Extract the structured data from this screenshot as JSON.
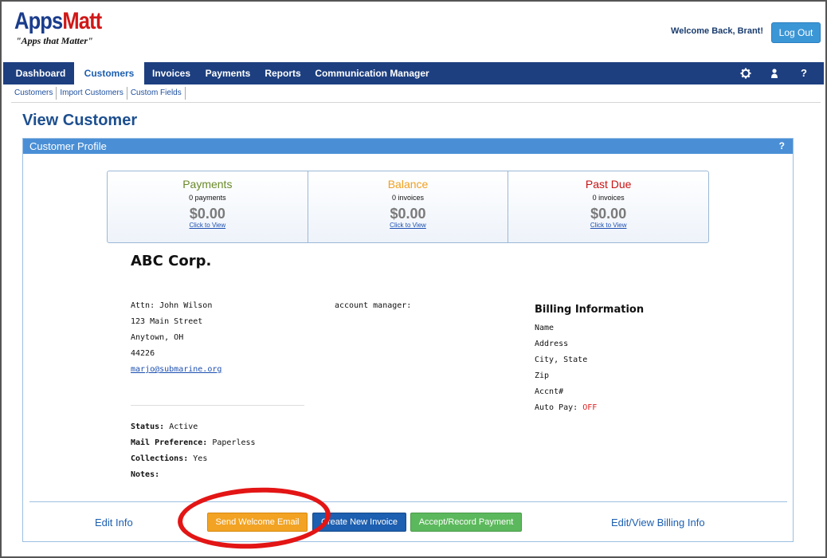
{
  "header": {
    "logo_main_a": "Apps",
    "logo_main_b": "Matt",
    "logo_tagline": "\"Apps that Matter\"",
    "welcome": "Welcome Back, Brant!",
    "logout_label": "Log Out"
  },
  "nav": {
    "items": [
      {
        "label": "Dashboard"
      },
      {
        "label": "Customers",
        "active": true
      },
      {
        "label": "Invoices"
      },
      {
        "label": "Payments"
      },
      {
        "label": "Reports"
      },
      {
        "label": "Communication Manager"
      }
    ],
    "icons": [
      "gear-icon",
      "user-icon",
      "help-icon"
    ],
    "help_glyph": "?"
  },
  "subnav": [
    "Customers",
    "Import Customers",
    "Custom Fields"
  ],
  "page_title": "View Customer",
  "panel": {
    "title": "Customer Profile",
    "help": "?"
  },
  "summary": [
    {
      "title": "Payments",
      "sub": "0 payments",
      "amount": "$0.00",
      "link": "Click to View",
      "color": "#6a8a2a"
    },
    {
      "title": "Balance",
      "sub": "0 invoices",
      "amount": "$0.00",
      "link": "Click to View",
      "color": "#f0a020"
    },
    {
      "title": "Past Due",
      "sub": "0 invoices",
      "amount": "$0.00",
      "link": "Click to View",
      "color": "#c81414"
    }
  ],
  "customer": {
    "company": "ABC Corp.",
    "attn": "Attn: John Wilson",
    "street": "123 Main Street",
    "city": "Anytown, OH",
    "zip": "44226",
    "email": "marjo@submarine.org",
    "account_manager_label": "account manager:",
    "status_label": "Status:",
    "status_value": "Active",
    "mail_label": "Mail Preference:",
    "mail_value": "Paperless",
    "collections_label": "Collections:",
    "collections_value": "Yes",
    "notes_label": "Notes:"
  },
  "billing": {
    "title": "Billing Information",
    "name": "Name",
    "address": "Address",
    "city_state": "City, State",
    "zip": "Zip",
    "acct": "Accnt#",
    "autopay_label": "Auto Pay:",
    "autopay_value": "OFF"
  },
  "actions": {
    "edit_info": "Edit Info",
    "send_welcome": "Send Welcome Email",
    "create_invoice": "Create New Invoice",
    "record_payment": "Accept/Record Payment",
    "edit_billing": "Edit/View Billing Info"
  },
  "colors": {
    "nav_bg": "#1d3f80",
    "panel_head": "#4a8fd6",
    "highlight": "#e31515"
  }
}
